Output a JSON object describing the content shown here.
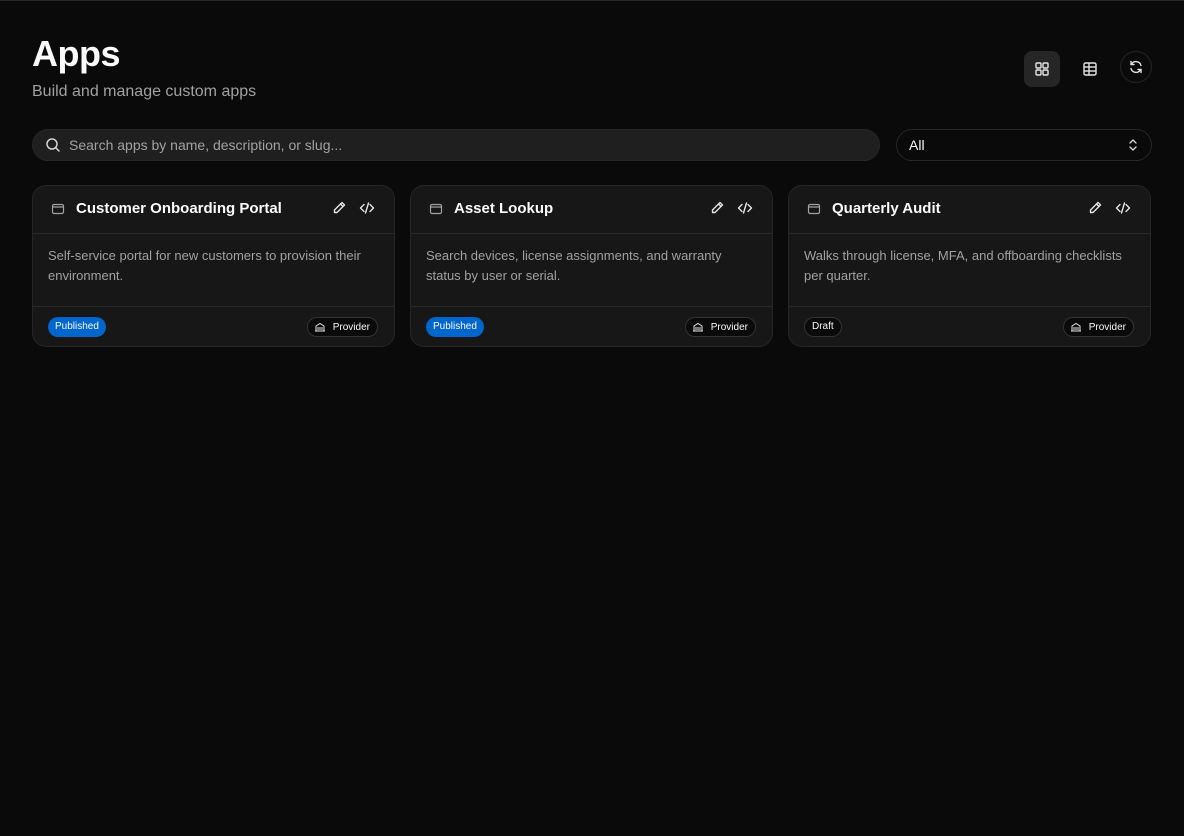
{
  "header": {
    "title": "Apps",
    "subtitle": "Build and manage custom apps"
  },
  "toolbar": {
    "grid_view_icon": "grid-icon",
    "table_view_icon": "table-icon",
    "refresh_icon": "refresh-icon"
  },
  "search": {
    "placeholder": "Search apps by name, description, or slug...",
    "value": ""
  },
  "filter": {
    "selected": "All"
  },
  "apps": [
    {
      "title": "Customer Onboarding Portal",
      "description": "Self-service portal for new customers to provision their environment.",
      "status": "Published",
      "scope": "Provider"
    },
    {
      "title": "Asset Lookup",
      "description": "Search devices, license assignments, and warranty status by user or serial.",
      "status": "Published",
      "scope": "Provider"
    },
    {
      "title": "Quarterly Audit",
      "description": "Walks through license, MFA, and offboarding checklists per quarter.",
      "status": "Draft",
      "scope": "Provider"
    }
  ],
  "colors": {
    "background": "#0a0a0a",
    "card": "#171717",
    "published": "#0066cc",
    "muted_text": "#a1a1a1"
  }
}
